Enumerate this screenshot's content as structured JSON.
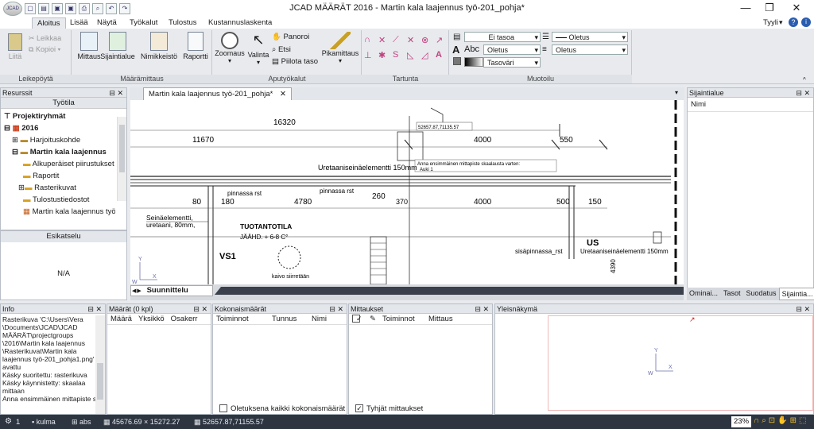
{
  "window": {
    "title": "JCAD MÄÄRÄT 2016 - Martin kala laajennus työ-201_pohja*",
    "app_logo": "JCAD"
  },
  "menu_tabs": [
    "Aloitus",
    "Lisää",
    "Näytä",
    "Työkalut",
    "Tulostus",
    "Kustannuslaskenta"
  ],
  "style_label": "Tyyli",
  "ribbon": {
    "clipboard": {
      "paste": "Liitä",
      "cut": "Leikkaa",
      "copy": "Kopioi",
      "group": "Leikepöytä"
    },
    "quantities": {
      "mittaus": "Mittaus",
      "sijaintialue": "Sijaintialue",
      "nimikkeisto": "Nimikkeistö",
      "raportti": "Raportti",
      "group": "Määrämittaus"
    },
    "tools": {
      "zoomaus": "Zoomaus",
      "valinta": "Valinta",
      "panoroi": "Panoroi",
      "etsi": "Etsi",
      "piilota": "Piilota taso",
      "pikamittaus": "Pikamittaus",
      "group": "Aputyökalut"
    },
    "snap": {
      "group": "Tartunta"
    },
    "format": {
      "layer": "Ei tasoa",
      "linetype": "Oletus",
      "textstyle": "Oletus",
      "linewidth": "Oletus",
      "color": "Tasoväri",
      "abc": "Abc",
      "group": "Muotoilu"
    }
  },
  "resources": {
    "title": "Resurssit",
    "worktab": "Työtila",
    "tree": [
      "Projektiryhmät",
      "2016",
      "Harjoituskohde",
      "Martin kala laajennus",
      "Alkuperäiset piirustukset",
      "Raportit",
      "Rasterikuvat",
      "Tulostustiedostot",
      "Martin kala laajennus työ"
    ],
    "preview_title": "Esikatselu",
    "preview_value": "N/A"
  },
  "document": {
    "tab": "Martin kala laajennus työ-201_pohja*",
    "bottom_tab": "Suunnittelu",
    "coord_box": "52657.87,71135.57",
    "hint": "Anna ensimmäinen mittapiste skaalausta varten:",
    "hint2": "Auki 1",
    "dims": {
      "d16320": "16320",
      "d11670": "11670",
      "d4000a": "4000",
      "d550": "550",
      "d80": "80",
      "d4780": "4780",
      "d260": "260",
      "d370": "370",
      "d4000b": "4000",
      "d500": "500",
      "d150": "150",
      "d4390": "4390"
    },
    "labels": {
      "uretaani_top": "Uretaaniseinäelementti 150mm",
      "pinnassa1": "pinnassa rst",
      "pinnassa2": "pinnassa rst",
      "seina1": "Seinäelementti,",
      "seina2": "uretaani, 80mm,",
      "tuotanto": "TUOTANTOTILA",
      "jaahd": "JÄÄHD. + 6-8  C°",
      "vs1": "VS1",
      "kaivo": "kaivo siirretään",
      "us": "US",
      "sisa": "sisäpinnassa_rst",
      "uretaani_r": "Uretaaniseinäelementti 150mm"
    }
  },
  "location_panel": {
    "title": "Sijaintialue",
    "column": "Nimi",
    "tabs": [
      "Ominai...",
      "Tasot",
      "Suodatus",
      "Sijaintia..."
    ]
  },
  "info_panel": {
    "title": "Info",
    "lines": [
      "Rasterikuva 'C:\\Users\\Vera",
      "\\Documents\\JCAD\\JCAD",
      "MÄÄRÄT\\projectgroups",
      "\\2016\\Martin kala laajennus",
      "\\Rasterikuvat\\Martin kala",
      "laajennus työ-201_pohja1.png'",
      "avattu",
      "Käsky suoritettu: rasterikuva",
      "Käsky käynnistetty: skaalaa",
      "mittaan",
      "Anna ensimmäinen mittapiste skaa"
    ]
  },
  "maarat_panel": {
    "title": "Määrät (0 kpl)",
    "columns": [
      "Määrä",
      "Yksikkö",
      "Osakerr"
    ]
  },
  "kokonais_panel": {
    "title": "Kokonaismäärät",
    "columns": [
      "Toiminnot",
      "Tunnus",
      "Nimi"
    ],
    "footer": "Oletuksena kaikki kokonaismäärät"
  },
  "mittaukset_panel": {
    "title": "Mittaukset",
    "columns": [
      "Toiminnot",
      "Mittaus"
    ],
    "footer": "Tyhjät mittaukset"
  },
  "overview_panel": {
    "title": "Yleisnäkymä"
  },
  "statusbar": {
    "one": "1",
    "kulma": "kulma",
    "abs": "abs",
    "coords": "45676.69 × 15272.27",
    "coords2": "52657.87,71155.57",
    "zoom": "23%"
  }
}
